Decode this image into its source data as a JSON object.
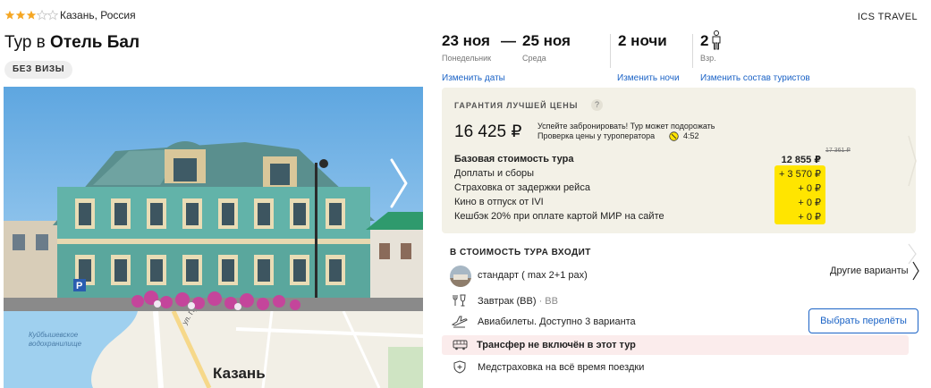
{
  "hotel": {
    "stars": 3,
    "max_stars": 5,
    "location": "Казань, Россия",
    "title_prefix": "Тур в",
    "title_name": "Отель Бал",
    "visa_badge": "БЕЗ ВИЗЫ",
    "operator": "ICS TRAVEL"
  },
  "photo": {
    "next_icon": "chevron-right-icon"
  },
  "map": {
    "city": "Казань",
    "water_label_1": "Куйбышевское",
    "water_label_2": "водохранилище",
    "street": "ул. Пушкина"
  },
  "dates": {
    "from_date": "23 ноя",
    "from_day": "Понедельник",
    "separator": "—",
    "to_date": "25 ноя",
    "to_day": "Среда",
    "nights": "2 ночи",
    "adults_count": "2",
    "adults_label": "Взр.",
    "change_dates": "Изменить даты",
    "change_nights": "Изменить ночи",
    "change_tourists": "Изменить состав туристов"
  },
  "price": {
    "guarantee": "ГАРАНТИЯ ЛУЧШЕЙ ЦЕНЫ",
    "guarantee_help": "?",
    "total": "16 425 ₽",
    "hurry_line1": "Успейте забронировать! Тур может подорожать",
    "hurry_line2": "Проверка цены у туроператора",
    "timer": "4:52",
    "old_price": "17 361 ₽",
    "rows": [
      {
        "label": "Базовая стоимость тура",
        "value": "12 855 ₽"
      },
      {
        "label": "Доплаты и сборы",
        "value": "+ 3 570 ₽"
      },
      {
        "label": "Страховка от задержки рейса",
        "value": "+ 0 ₽"
      },
      {
        "label": "Кино в отпуск от IVI",
        "value": "+ 0 ₽"
      },
      {
        "label": "Кешбэк 20% при оплате картой МИР на сайте",
        "value": "+ 0 ₽"
      }
    ]
  },
  "includes": {
    "title": "В СТОИМОСТЬ ТУРА ВХОДИТ",
    "room": "стандарт ( max 2+1 pax)",
    "other_variants": "Другие варианты",
    "meal": "Завтрак (BB)",
    "meal_sep": " · ",
    "meal_code": "BB",
    "flights": "Авиабилеты. Доступно 3 варианта",
    "choose_flights": "Выбрать перелёты",
    "transfer": "Трансфер не включён в этот тур",
    "insurance": "Медстраховка на всё время поездки"
  },
  "colors": {
    "accent": "#1b63c6",
    "star": "#f5a623",
    "panel": "#f3f1e7",
    "yellow": "#ffe500",
    "transfer_bg": "#fbecec"
  }
}
